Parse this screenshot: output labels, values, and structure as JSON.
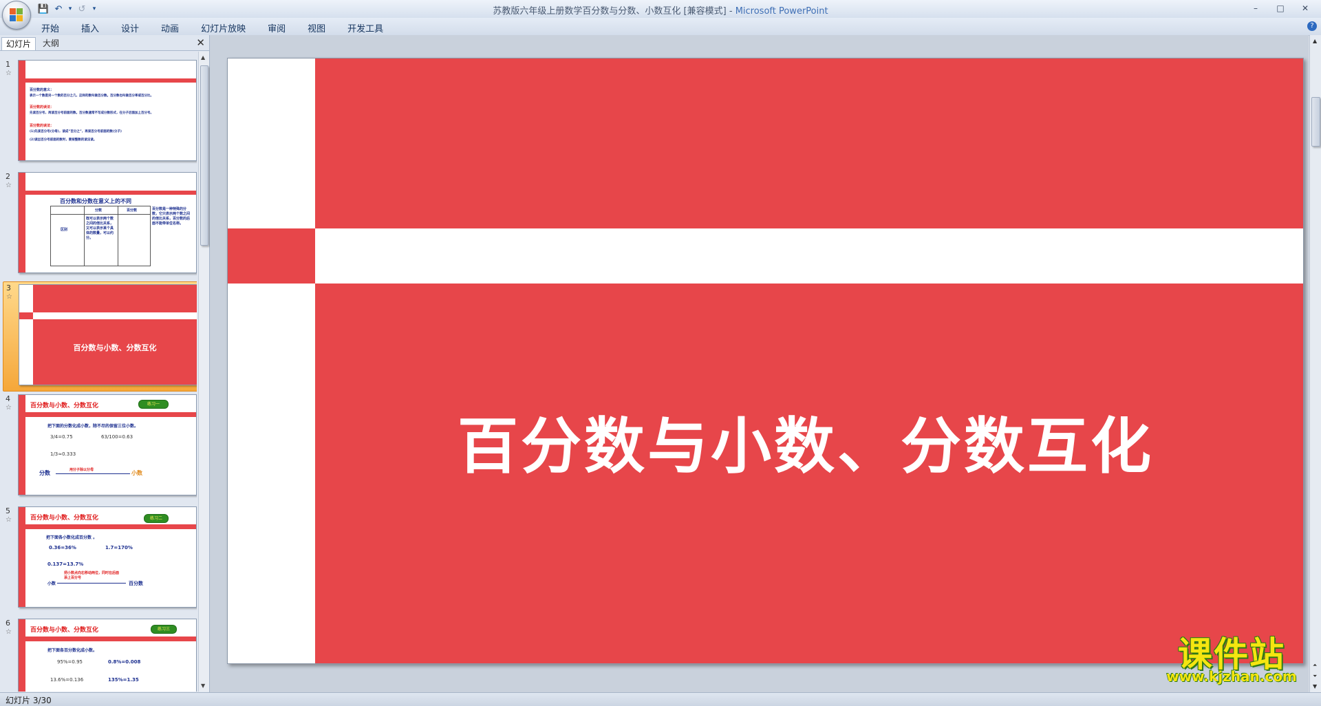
{
  "window": {
    "title": "苏教版六年级上册数学百分数与分数、小数互化 [兼容模式]",
    "separator": "-",
    "app_name": "Microsoft PowerPoint",
    "controls": [
      "–",
      "□",
      "✕"
    ]
  },
  "qat": {
    "save": "💾",
    "undo": "↶",
    "undo_menu": "▾",
    "redo": "↺",
    "customize": "▾"
  },
  "ribbon": {
    "tabs": [
      "开始",
      "插入",
      "设计",
      "动画",
      "幻灯片放映",
      "审阅",
      "视图",
      "开发工具"
    ],
    "help": "?"
  },
  "left_pane": {
    "tab_slides": "幻灯片",
    "tab_outline": "大纲",
    "close": "✕",
    "selected_index": 3
  },
  "thumbnails": [
    {
      "num": "1",
      "lines": [
        {
          "t": "百分数的意义：",
          "c": "#e02020"
        },
        {
          "t": "表示一个数是另一个数的百分之几，这样的数叫做百分数。百分数也叫做百分率或百分比。",
          "c": "#1c2f8f"
        },
        {
          "t": "百分数的读法：",
          "c": "#e02020"
        },
        {
          "t": "先读百分号，再读百分号前面的数。百分数通常不写成分数形式，在分子后面加上百分号。",
          "c": "#1c2f8f"
        },
        {
          "t": "百分数的读法：",
          "c": "#e02020"
        },
        {
          "t": "(1)先读百分号(分母)，读成“百分之”，再读百分号前面的数(分子)",
          "c": "#1c2f8f"
        },
        {
          "t": "(2)读出百分号前面的数时，要按整数的读法读。",
          "c": "#1c2f8f"
        }
      ]
    },
    {
      "num": "2",
      "title": "百分数和分数在意义上的不同",
      "headers": [
        "分数",
        "百分数"
      ],
      "row_label": "区别",
      "cell": "既可以表示两个数之间的倍比关系，又可以表示某个具体的数量，可以约分。",
      "side": "百分数是一种特殊的分数，它只表示两个数之间的倍比关系，百分数的后面不能带单位名称。"
    },
    {
      "num": "3",
      "title": "百分数与小数、分数互化"
    },
    {
      "num": "4",
      "title": "百分数与小数、分数互化",
      "badge": "练习一",
      "instruction": "把下面的分数化成小数，除不尽的保留三位小数。",
      "items": [
        "3/4=0.75",
        "63/100=0.63",
        "1/3≈0.333"
      ],
      "from": "分数",
      "arrow_label": "用分子除以分母",
      "to": "小数"
    },
    {
      "num": "5",
      "title": "百分数与小数、分数互化",
      "badge": "练习二",
      "instruction": "把下面各小数化成百分数 。",
      "items": [
        "0.36=36%",
        "1.7=170%",
        "0.137=13.7%"
      ],
      "from": "小数",
      "arrow_label": "把小数点向右移动两位，同时在后面添上百分号",
      "to": "百分数"
    },
    {
      "num": "6",
      "title": "百分数与小数、分数互化",
      "badge": "练习三",
      "instruction": "把下面各百分数化成小数。",
      "items": [
        "95%=0.95",
        "0.8%=0.008",
        "13.6%=0.136",
        "135%=1.35"
      ]
    }
  ],
  "slide": {
    "title": "百分数与小数、分数互化"
  },
  "status": {
    "text": "幻灯片 3/30"
  },
  "watermark": {
    "big": "课件站",
    "url": "www.kjzhan.com"
  },
  "colors": {
    "accent_red": "#e7464a",
    "ribbon_blue": "#15345e",
    "selection_orange": "#f5a73a"
  }
}
